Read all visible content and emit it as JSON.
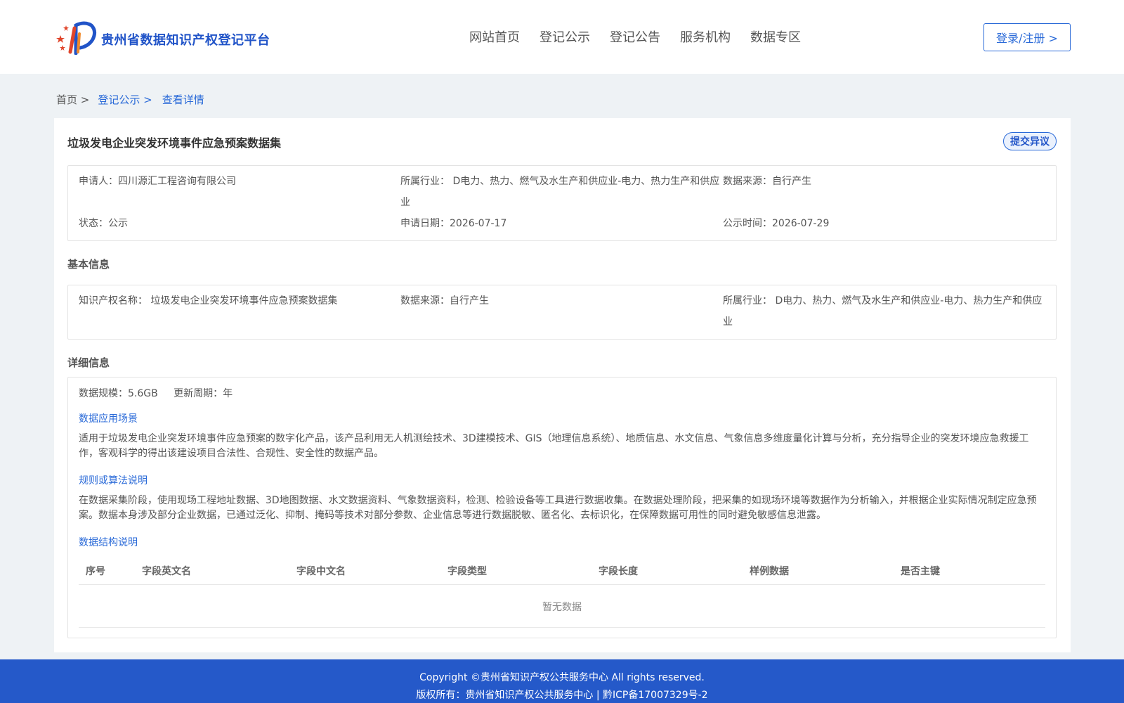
{
  "header": {
    "site_title": "贵州省数据知识产权登记平台",
    "nav": [
      "网站首页",
      "登记公示",
      "登记公告",
      "服务机构",
      "数据专区"
    ],
    "login_label": "登录/注册 >"
  },
  "breadcrumb": {
    "home": "首页 >",
    "section": "登记公示 >",
    "current": "查看详情"
  },
  "record": {
    "title": "垃圾发电企业突发环境事件应急预案数据集",
    "objection_label": "提交异议",
    "applicant": "申请人：四川源汇工程咨询有限公司",
    "industry": "所属行业： D电力、热力、燃气及水生产和供应业-电力、热力生产和供应业",
    "data_source": "数据来源：自行产生",
    "status": "状态：公示",
    "apply_date": "申请日期：2026-07-17",
    "publicity_date": "公示时间：2026-07-29"
  },
  "basic": {
    "section_title": "基本信息",
    "ip_name": "知识产权名称： 垃圾发电企业突发环境事件应急预案数据集",
    "data_source": "数据来源：自行产生",
    "industry": "所属行业： D电力、热力、燃气及水生产和供应业-电力、热力生产和供应业"
  },
  "detail": {
    "section_title": "详细信息",
    "scale": "数据规模：5.6GB",
    "update_cycle": "更新周期：年",
    "scenario_title": "数据应用场景",
    "scenario_text": "适用于垃圾发电企业突发环境事件应急预案的数字化产品，该产品利用无人机测绘技术、3D建模技术、GIS（地理信息系统）、地质信息、水文信息、气象信息多维度量化计算与分析，充分指导企业的突发环境应急救援工作，客观科学的得出该建设项目合法性、合规性、安全性的数据产品。",
    "rule_title": "规则或算法说明",
    "rule_text": "在数据采集阶段，使用现场工程地址数据、3D地图数据、水文数据资料、气象数据资料，检测、检验设备等工具进行数据收集。在数据处理阶段，把采集的如现场环境等数据作为分析输入，并根据企业实际情况制定应急预案。数据本身涉及部分企业数据，已通过泛化、抑制、掩码等技术对部分参数、企业信息等进行数据脱敏、匿名化、去标识化，在保障数据可用性的同时避免敏感信息泄露。",
    "structure_title": "数据结构说明",
    "table_columns": [
      "序号",
      "字段英文名",
      "字段中文名",
      "字段类型",
      "字段长度",
      "样例数据",
      "是否主键"
    ],
    "table_empty": "暂无数据"
  },
  "footer": {
    "copyright": "Copyright ©贵州省知识产权公共服务中心 All rights reserved.",
    "icp": "版权所有：贵州省知识产权公共服务中心 | 黔ICP备17007329号-2"
  },
  "colors": {
    "brand_blue": "#2154c8",
    "link_blue": "#2a6ad8",
    "footer_blue": "#2559c9",
    "logo_red": "#e0452b",
    "logo_orange": "#f08a2c"
  }
}
